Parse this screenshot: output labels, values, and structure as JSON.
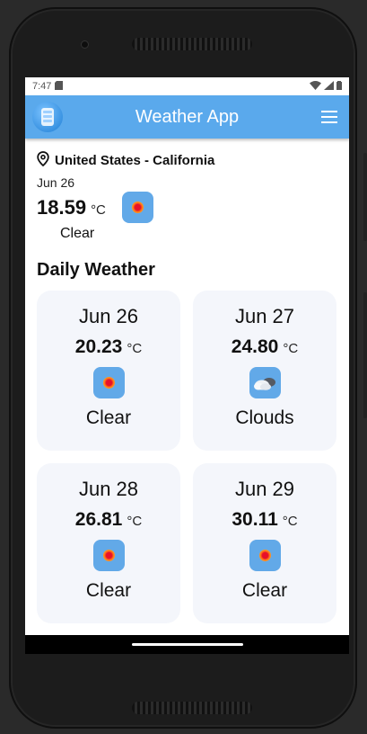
{
  "status_bar": {
    "time": "7:47"
  },
  "app_bar": {
    "title": "Weather App"
  },
  "current": {
    "location": "United States - California",
    "date": "Jun 26",
    "temp": "18.59",
    "unit": "°C",
    "description": "Clear",
    "icon": "clear-sun"
  },
  "daily": {
    "title": "Daily Weather",
    "items": [
      {
        "date": "Jun 26",
        "temp": "20.23",
        "unit": "°C",
        "description": "Clear",
        "icon": "clear-sun"
      },
      {
        "date": "Jun 27",
        "temp": "24.80",
        "unit": "°C",
        "description": "Clouds",
        "icon": "clouds"
      },
      {
        "date": "Jun 28",
        "temp": "26.81",
        "unit": "°C",
        "description": "Clear",
        "icon": "clear-sun"
      },
      {
        "date": "Jun 29",
        "temp": "30.11",
        "unit": "°C",
        "description": "Clear",
        "icon": "clear-sun"
      }
    ]
  },
  "colors": {
    "app_bar": "#5aa9ec",
    "icon_tile": "#62a9e8",
    "card_bg": "#f4f6fb"
  }
}
